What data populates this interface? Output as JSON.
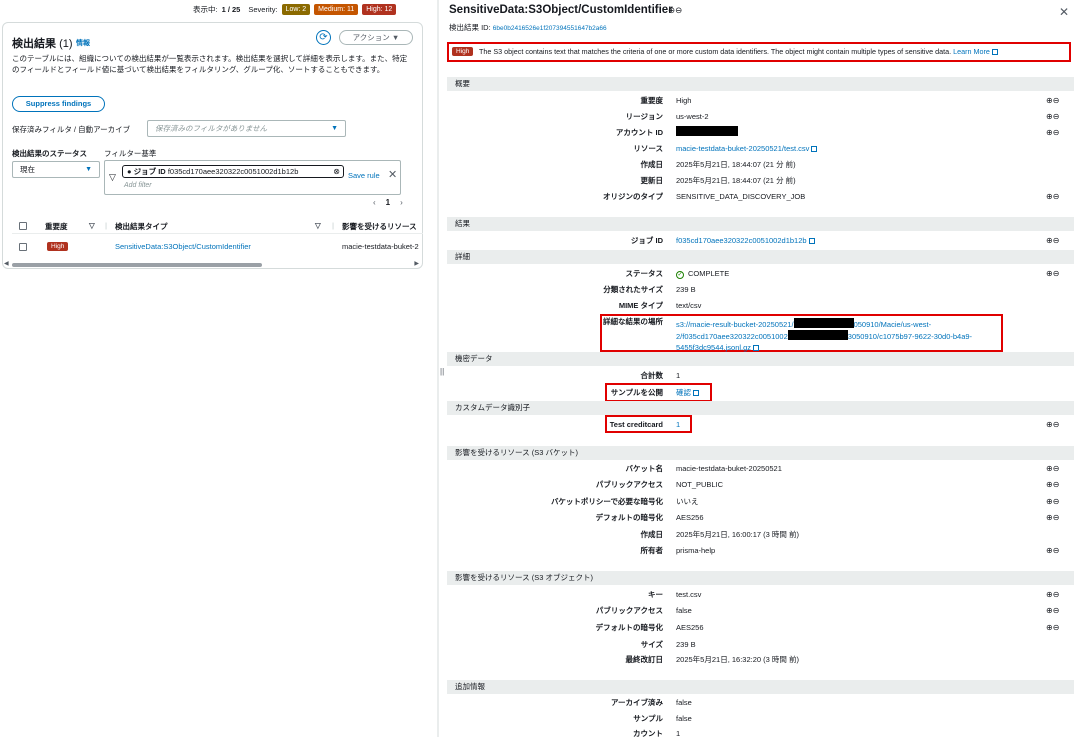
{
  "topbar": {
    "showing_label": "表示中:",
    "showing_value": "1 / 25",
    "severity_label": "Severity:",
    "low": "Low: 2",
    "medium": "Medium: 11",
    "high": "High: 12"
  },
  "left": {
    "title": "検出結果",
    "count": "(1)",
    "info": "情報",
    "action": "アクション ▼",
    "description": "このテーブルには、組織についての検出結果が一覧表示されます。検出結果を選択して詳細を表示します。また、特定のフィールドとフィールド値に基づいて検出結果をフィルタリング、グループ化、ソートすることもできます。",
    "suppress": "Suppress findings",
    "saved_label": "保存済みフィルタ / 自動アーカイブ",
    "saved_placeholder": "保存済みのフィルタがありません",
    "status_label": "検出結果のステータス",
    "filter_label": "フィルター基準",
    "status_value": "現在",
    "token_key": "ジョブ ID",
    "token_value": "f035cd170aee320322c0051002d1b12b",
    "add_filter": "Add filter",
    "save_rule": "Save rule",
    "page": "1",
    "headers": {
      "severity": "重要度",
      "type": "検出結果タイプ",
      "resource": "影響を受けるリソース"
    },
    "rows": [
      {
        "severity": "High",
        "type": "SensitiveData:S3Object/CustomIdentifier",
        "resource": "macie-testdata-buket-2"
      }
    ]
  },
  "detail": {
    "title": "SensitiveData:S3Object/CustomIdentifier",
    "id_label": "検出結果 ID:",
    "id_value": "6be0b2416526e1f207394551647b2a66",
    "alert_sev": "High",
    "alert_text": "The S3 object contains text that matches the criteria of one or more custom data identifiers. The object might contain multiple types of sensitive data.",
    "learn_more": "Learn More",
    "sec_overview": "概要",
    "overview": [
      {
        "k": "重要度",
        "v": "High"
      },
      {
        "k": "リージョン",
        "v": "us-west-2"
      },
      {
        "k": "アカウント ID",
        "v": ""
      },
      {
        "k": "リソース",
        "v": "macie-testdata-buket-20250521/test.csv"
      },
      {
        "k": "作成日",
        "v": "2025年5月21日, 18:44:07 (21 分 前)"
      },
      {
        "k": "更新日",
        "v": "2025年5月21日, 18:44:07 (21 分 前)"
      },
      {
        "k": "オリジンのタイプ",
        "v": "SENSITIVE_DATA_DISCOVERY_JOB"
      }
    ],
    "sec_result": "結果",
    "job_id_k": "ジョブ ID",
    "job_id_v": "f035cd170aee320322c0051002d1b12b",
    "sec_detail": "詳細",
    "status_k": "ステータス",
    "status_v": "COMPLETE",
    "size_k": "分類されたサイズ",
    "size_v": "239 B",
    "mime_k": "MIME タイプ",
    "mime_v": "text/csv",
    "loc_k": "詳細な結果の場所",
    "loc_l1a": "s3://macie-result-bucket-20250521/",
    "loc_l1b": "050910/Macie/us-west-",
    "loc_l2a": "2/f035cd170aee320322c0051002",
    "loc_l2b": "3050910/c1075b97-9622-30d0-b4a9-",
    "loc_l3": "5455f3dc9544.jsonl.gz",
    "sec_sensitive": "機密データ",
    "total_k": "合計数",
    "total_v": "1",
    "sample_k": "サンプルを公開",
    "sample_v": "確認",
    "sec_custom": "カスタムデータ識別子",
    "cc_k": "Test creditcard",
    "cc_v": "1",
    "sec_bucket": "影響を受けるリソース (S3 バケット)",
    "bucket": [
      {
        "k": "バケット名",
        "v": "macie-testdata-buket-20250521"
      },
      {
        "k": "パブリックアクセス",
        "v": "NOT_PUBLIC"
      },
      {
        "k": "バケットポリシーで必要な暗号化",
        "v": "いいえ"
      },
      {
        "k": "デフォルトの暗号化",
        "v": "AES256"
      },
      {
        "k": "作成日",
        "v": "2025年5月21日, 16:00:17 (3 時間 前)"
      },
      {
        "k": "所有者",
        "v": "prisma-help"
      }
    ],
    "sec_object": "影響を受けるリソース (S3 オブジェクト)",
    "object": [
      {
        "k": "キー",
        "v": "test.csv"
      },
      {
        "k": "パブリックアクセス",
        "v": "false"
      },
      {
        "k": "デフォルトの暗号化",
        "v": "AES256"
      },
      {
        "k": "サイズ",
        "v": "239 B"
      },
      {
        "k": "最終改訂日",
        "v": "2025年5月21日, 16:32:20 (3 時間 前)"
      }
    ],
    "sec_extra": "追加情報",
    "extra": [
      {
        "k": "アーカイブ済み",
        "v": "false"
      },
      {
        "k": "サンプル",
        "v": "false"
      },
      {
        "k": "カウント",
        "v": "1"
      }
    ]
  },
  "icons": {
    "zoom": "zoom-in-out-icon",
    "close": "close-icon",
    "external": "external-link-icon"
  },
  "colors": {
    "accent": "#0073bb",
    "high": "#b0321f",
    "medium": "#c45500",
    "low": "#8b6a00",
    "highlight": "#e00000"
  }
}
